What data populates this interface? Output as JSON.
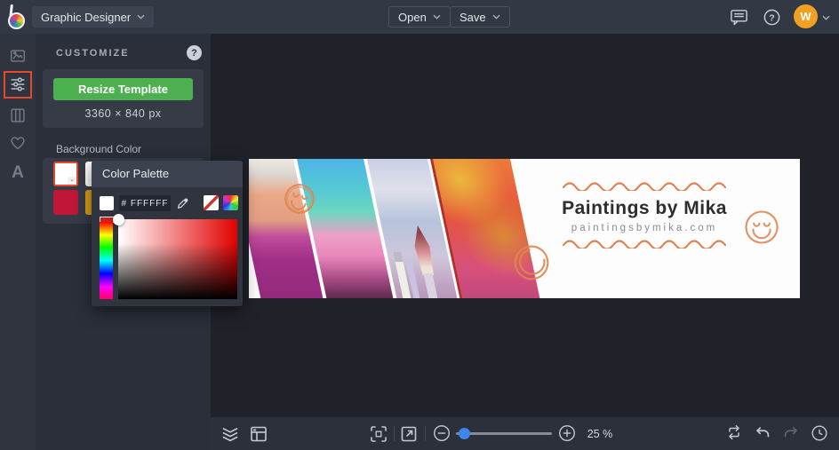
{
  "topbar": {
    "app_menu": "Graphic Designer",
    "open_label": "Open",
    "save_label": "Save",
    "avatar_initial": "W"
  },
  "panel": {
    "title": "CUSTOMIZE",
    "help_glyph": "?",
    "resize_button": "Resize Template",
    "dimensions": "3360 × 840 px",
    "background_label": "Background Color",
    "swatches": [
      {
        "color": "#ffffff",
        "selected": true
      },
      {
        "color": "#ffffff",
        "selected": false
      },
      {
        "color": "#c01638",
        "selected": false
      },
      {
        "color": "#dda11c",
        "selected": false
      }
    ]
  },
  "popup": {
    "title": "Color Palette",
    "hex_value": "# FFFFFF"
  },
  "design": {
    "title": "Paintings by Mika",
    "website": "paintingsbymika.com",
    "accent_color": "#e0854f"
  },
  "toolbar": {
    "zoom_level": "25 %"
  },
  "colors": {
    "selection_red": "#e4492e",
    "button_green": "#4db050",
    "avatar_orange": "#f2a024",
    "slider_blue": "#3d87ea",
    "swatch_crimson": "#c01638",
    "swatch_amber": "#dda11c"
  }
}
